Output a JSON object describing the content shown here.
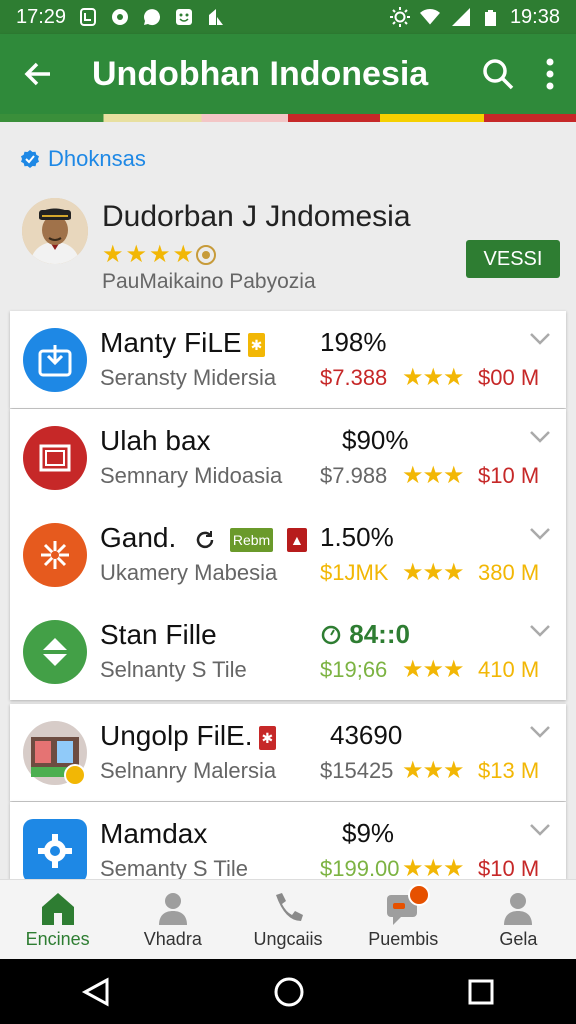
{
  "status": {
    "time_left": "17:29",
    "time_right": "19:38"
  },
  "header": {
    "title": "Undobhan Indonesia",
    "back_icon": "arrow-left-icon",
    "search_icon": "search-icon",
    "menu_icon": "more-vert-icon"
  },
  "verified": {
    "label": "Dhoknsas"
  },
  "profile": {
    "name": "Dudorban J Jndomesia",
    "subtitle": "PauMaikaino Pabyozia",
    "rating": 4,
    "button": "VESSI"
  },
  "items": [
    {
      "name": "Manty FiLE",
      "subtitle": "Seransty Midersia",
      "pct": "198%",
      "price": "$7.388",
      "amount": "$00 M",
      "stars": 3,
      "price_color": "#c62828",
      "amount_color": "#c62828",
      "icon": "download-icon",
      "icon_bg": "#1e88e5",
      "badge": "✱",
      "badge_color": "#f2b705"
    },
    {
      "name": "Ulah bax",
      "subtitle": "Semnary Midoasia",
      "pct": "$90%",
      "price": "$7.988",
      "amount": "$10 M",
      "stars": 3,
      "price_color": "#666666",
      "amount_color": "#c62828",
      "icon": "window-icon",
      "icon_bg": "#c62828"
    },
    {
      "name": "Gand.",
      "subtitle": "Ukamery Mabesia",
      "pct": "1.50%",
      "price": "$1JMK",
      "amount": "380 M",
      "stars": 3,
      "price_color": "#f2b705",
      "amount_color": "#f2b705",
      "icon": "burst-icon",
      "icon_bg": "#e65a1e",
      "badge": "Rebm",
      "badge_color": "#6a9a2a"
    },
    {
      "name": "Stan Fille",
      "subtitle": "Selnanty S Tile",
      "pct": "84::0",
      "price": "$19;66",
      "amount": "410 M",
      "stars": 3,
      "price_color": "#7cb342",
      "amount_color": "#f2b705",
      "icon": "swap-icon",
      "icon_bg": "#43a047",
      "pct_color": "#2e7d32"
    },
    {
      "name": "Ungolp FilE.",
      "subtitle": "Selnanry Malersia",
      "pct": "43690",
      "price": "$15425",
      "amount": "$13 M",
      "stars": 3,
      "price_color": "#666666",
      "amount_color": "#f2b705",
      "icon": "photo-icon",
      "icon_bg": "#8d6e63",
      "badge": "✱",
      "badge_color": "#c62828"
    },
    {
      "name": "Mamdax",
      "subtitle": "Semanty S Tile",
      "pct": "$9%",
      "price": "$199.00",
      "amount": "$10 M",
      "stars": 3,
      "price_color": "#7cb342",
      "amount_color": "#c62828",
      "icon": "gear-icon",
      "icon_bg": "#1e88e5"
    }
  ],
  "nav": [
    {
      "label": "Encines",
      "icon": "home-icon"
    },
    {
      "label": "Vhadra",
      "icon": "person-icon"
    },
    {
      "label": "Ungcaiis",
      "icon": "phone-icon"
    },
    {
      "label": "Puembis",
      "icon": "chat-icon"
    },
    {
      "label": "Gela",
      "icon": "account-icon"
    }
  ]
}
